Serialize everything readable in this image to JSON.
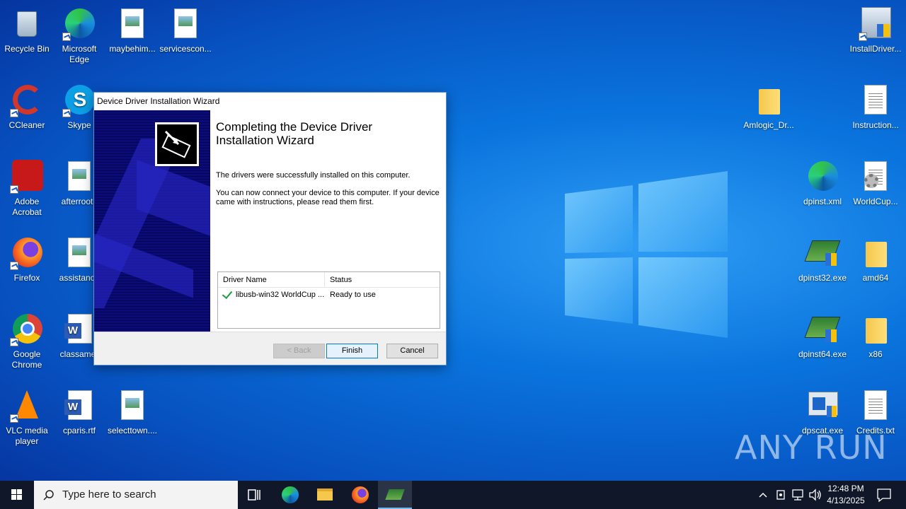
{
  "desktop": {
    "left_icons": [
      {
        "label": "Recycle Bin",
        "icon": "recycle-bin-icon"
      },
      {
        "label": "Microsoft Edge",
        "icon": "edge-icon"
      },
      {
        "label": "maybehim...",
        "icon": "image-file-icon"
      },
      {
        "label": "servicescon...",
        "icon": "image-file-icon"
      },
      {
        "label": "CCleaner",
        "icon": "ccleaner-icon"
      },
      {
        "label": "Skype",
        "icon": "skype-icon"
      },
      {
        "label": "Adobe Acrobat",
        "icon": "acrobat-icon"
      },
      {
        "label": "afterroot.j",
        "icon": "image-file-icon"
      },
      {
        "label": "Firefox",
        "icon": "firefox-icon"
      },
      {
        "label": "assistance",
        "icon": "image-file-icon"
      },
      {
        "label": "Google Chrome",
        "icon": "chrome-icon"
      },
      {
        "label": "classamer",
        "icon": "word-doc-icon"
      },
      {
        "label": "VLC media player",
        "icon": "vlc-icon"
      },
      {
        "label": "cparis.rtf",
        "icon": "word-doc-icon"
      },
      {
        "label": "selecttown....",
        "icon": "image-file-icon"
      }
    ],
    "right_icons": [
      {
        "label": "InstallDriver...",
        "icon": "installer-icon"
      },
      {
        "label": "Amlogic_Dr...",
        "icon": "folder-icon"
      },
      {
        "label": "Instruction...",
        "icon": "text-file-icon"
      },
      {
        "label": "dpinst.xml",
        "icon": "edge-icon"
      },
      {
        "label": "WorldCup...",
        "icon": "settings-file-icon"
      },
      {
        "label": "dpinst32.exe",
        "icon": "installer-exe-icon"
      },
      {
        "label": "amd64",
        "icon": "folder-icon"
      },
      {
        "label": "dpinst64.exe",
        "icon": "installer-exe-icon"
      },
      {
        "label": "x86",
        "icon": "folder-icon"
      },
      {
        "label": "dpscat.exe",
        "icon": "dpscat-icon"
      },
      {
        "label": "Credits.txt",
        "icon": "text-file-icon"
      }
    ]
  },
  "dialog": {
    "title": "Device Driver Installation Wizard",
    "heading": "Completing the Device Driver Installation Wizard",
    "message1": "The drivers were successfully installed on this computer.",
    "message2": "You can now connect your device to this computer. If your device came with instructions, please read them first.",
    "table": {
      "headers": [
        "Driver Name",
        "Status"
      ],
      "rows": [
        {
          "name": "libusb-win32 WorldCup ...",
          "status": "Ready to use"
        }
      ]
    },
    "buttons": {
      "back": "< Back",
      "finish": "Finish",
      "cancel": "Cancel"
    }
  },
  "taskbar": {
    "search_placeholder": "Type here to search",
    "time": "12:48 PM",
    "date": "4/13/2025"
  },
  "watermark": "ANY RUN"
}
